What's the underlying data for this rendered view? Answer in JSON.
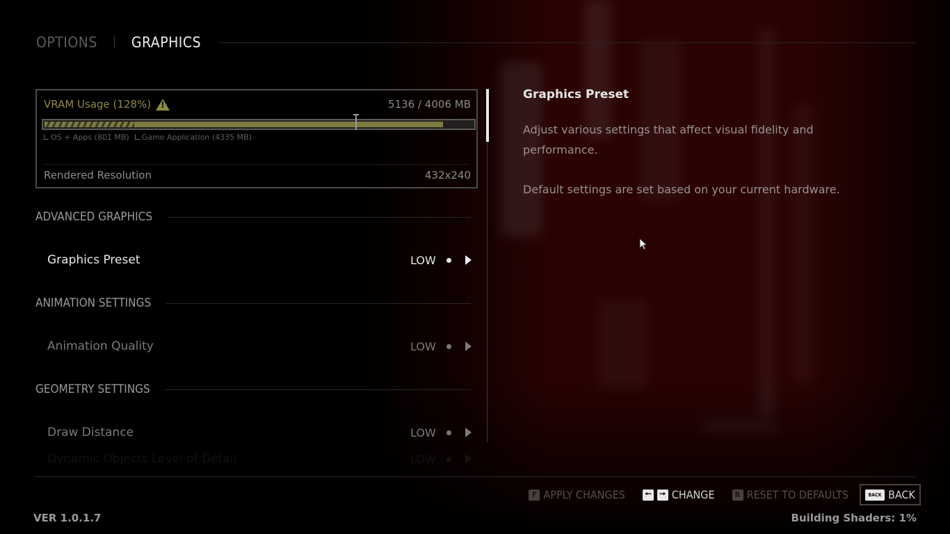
{
  "header": {
    "tabs": [
      {
        "label": "OPTIONS",
        "active": false
      },
      {
        "label": "GRAPHICS",
        "active": true
      }
    ]
  },
  "vram": {
    "title": "VRAM Usage (128%)",
    "warning_icon": "warning-triangle-icon",
    "amount": "5136 / 4006 MB",
    "used_mb": 5136,
    "budget_mb": 4006,
    "os_apps_mb": 801,
    "game_mb": 4335,
    "os_apps_fraction_of_bar": 0.21,
    "total_fraction_of_bar": 0.93,
    "budget_marker_fraction_of_bar": 0.725,
    "legend": {
      "os_apps": "OS + Apps (801 MB)",
      "game": "Game Application (4335 MB)"
    },
    "colors": {
      "accent": "#8d8a48"
    },
    "resolution_label": "Rendered Resolution",
    "resolution_value": "432x240"
  },
  "sections": [
    {
      "title": "ADVANCED GRAPHICS",
      "settings": [
        {
          "label": "Graphics Preset",
          "value": "LOW",
          "state": "active"
        }
      ]
    },
    {
      "title": "ANIMATION SETTINGS",
      "settings": [
        {
          "label": "Animation Quality",
          "value": "LOW",
          "state": "dim"
        }
      ]
    },
    {
      "title": "GEOMETRY SETTINGS",
      "settings": [
        {
          "label": "Draw Distance",
          "value": "LOW",
          "state": "dim"
        },
        {
          "label": "Dynamic Objects Level of Detail",
          "value": "LOW",
          "state": "faded"
        }
      ]
    }
  ],
  "description": {
    "title": "Graphics Preset",
    "paragraphs": [
      "Adjust various settings that affect visual fidelity and performance.",
      "Default settings are set based on your current hardware."
    ]
  },
  "footer": {
    "actions": [
      {
        "key": "F",
        "label": "APPLY CHANGES",
        "enabled": false
      },
      {
        "key": "arrows",
        "label": "CHANGE",
        "enabled": true
      },
      {
        "key": "R",
        "label": "RESET TO DEFAULTS",
        "enabled": false
      },
      {
        "key": "BACK",
        "label": "BACK",
        "enabled": true
      }
    ],
    "version": "VER 1.0.1.7",
    "shader_status": "Building Shaders: 1%"
  }
}
